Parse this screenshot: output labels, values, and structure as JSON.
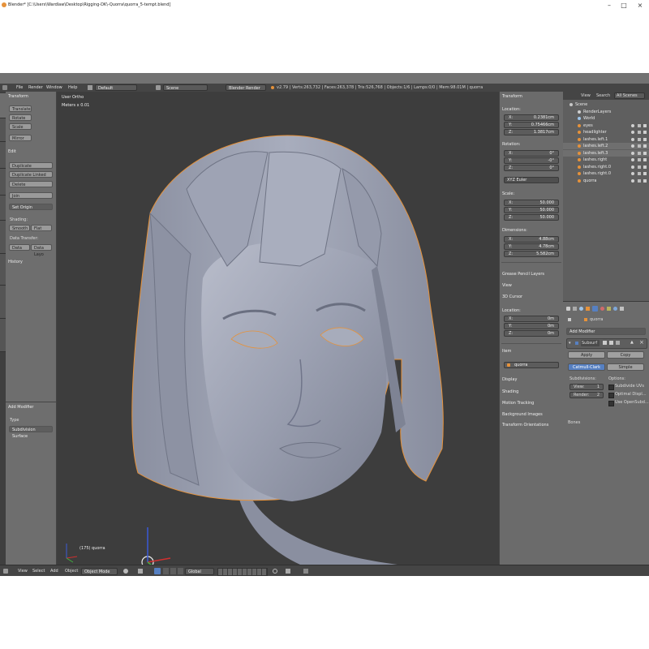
{
  "window": {
    "title": "Blender* [C:\\Users\\Wardlaw\\Desktop\\Rigging-DK\\-Quorra\\quorra_5-tempt.blend]"
  },
  "menu": {
    "file": "File",
    "render": "Render",
    "window": "Window",
    "help": "Help"
  },
  "header": {
    "layout": "Default",
    "scene": "Scene",
    "engine": "Blender Render",
    "stats": "v2.79 | Verts:263,732 | Faces:263,378 | Tris:526,768 | Objects:1/6 | Lamps:0/0 | Mem:98.01M | quorra"
  },
  "tools": {
    "transform_header": "Transform",
    "translate": "Translate",
    "rotate": "Rotate",
    "scale": "Scale",
    "mirror": "Mirror",
    "edit_header": "Edit",
    "duplicate": "Duplicate",
    "duplicate_linked": "Duplicate Linked",
    "delete": "Delete",
    "join": "Join",
    "set_origin": "Set Origin",
    "shading_label": "Shading:",
    "smooth": "Smooth",
    "flat": "Flat",
    "data_transfer_label": "Data Transfer:",
    "data": "Data",
    "data_layout": "Data Layo",
    "history_header": "History",
    "add_modifier_header": "Add Modifier",
    "type_label": "Type",
    "type_value": "Subdivision Surface"
  },
  "viewport": {
    "view_label": "User Ortho",
    "meters_label": "Meters x 0.01",
    "object_label": "(175) quorra"
  },
  "transform_panel": {
    "header": "Transform",
    "location_label": "Location:",
    "location": [
      {
        "axis": "X:",
        "value": "0.2381cm"
      },
      {
        "axis": "Y:",
        "value": "0.75466cm"
      },
      {
        "axis": "Z:",
        "value": "1.3817cm"
      }
    ],
    "rotation_label": "Rotation:",
    "rotation": [
      {
        "axis": "X:",
        "value": "0°"
      },
      {
        "axis": "Y:",
        "value": "-0°"
      },
      {
        "axis": "Z:",
        "value": "0°"
      }
    ],
    "rotation_mode": "XYZ Euler",
    "scale_label": "Scale:",
    "scale": [
      {
        "axis": "X:",
        "value": "50.000"
      },
      {
        "axis": "Y:",
        "value": "50.000"
      },
      {
        "axis": "Z:",
        "value": "50.000"
      }
    ],
    "dimensions_label": "Dimensions:",
    "dimensions": [
      {
        "axis": "X:",
        "value": "4.88cm"
      },
      {
        "axis": "Y:",
        "value": "4.78cm"
      },
      {
        "axis": "Z:",
        "value": "5.582cm"
      }
    ],
    "grease_pencil": "Grease Pencil Layers",
    "view": "View",
    "cursor": "3D Cursor",
    "cursor_location_label": "Location:",
    "cursor_location": [
      {
        "axis": "X:",
        "value": "0m"
      },
      {
        "axis": "Y:",
        "value": "0m"
      },
      {
        "axis": "Z:",
        "value": "0m"
      }
    ],
    "item": "Item",
    "item_name": "quorra",
    "display": "Display",
    "shading": "Shading",
    "motion_tracking": "Motion Tracking",
    "background_images": "Background Images",
    "transform_orientations": "Transform Orientations"
  },
  "outliner": {
    "menu_view": "View",
    "menu_search": "Search",
    "menu_scenes": "All Scenes",
    "items": [
      {
        "label": "Scene",
        "indent": 0,
        "icon_color": "#c8c8c8"
      },
      {
        "label": "RenderLayers",
        "indent": 1,
        "icon_color": "#cfcfcf"
      },
      {
        "label": "World",
        "indent": 1,
        "icon_color": "#9ec4e8"
      },
      {
        "label": "eyes",
        "indent": 1,
        "icon_color": "#e6923a"
      },
      {
        "label": "headlighter",
        "indent": 1,
        "icon_color": "#e6923a"
      },
      {
        "label": "lashes.left.1",
        "indent": 1,
        "icon_color": "#e6923a"
      },
      {
        "label": "lashes.left.2",
        "indent": 1,
        "icon_color": "#e6923a"
      },
      {
        "label": "lashes.left.3",
        "indent": 1,
        "icon_color": "#e6923a"
      },
      {
        "label": "lashes.right",
        "indent": 1,
        "icon_color": "#e6923a"
      },
      {
        "label": "lashes.right.0",
        "indent": 1,
        "icon_color": "#e6923a"
      },
      {
        "label": "lashes.right.0",
        "indent": 1,
        "icon_color": "#e6923a"
      },
      {
        "label": "quorra",
        "indent": 1,
        "icon_color": "#e6923a"
      }
    ]
  },
  "properties": {
    "breadcrumb": "quorra",
    "add_modifier": "Add Modifier",
    "modifier_name": "Subsurf",
    "apply": "Apply",
    "copy": "Copy",
    "catmull_clark": "Catmull-Clark",
    "simple": "Simple",
    "subdivisions_label": "Subdivisions:",
    "view_label": "View:",
    "view_value": "1",
    "render_label": "Render:",
    "render_value": "2",
    "options_label": "Options:",
    "subdivide_uvs": "Subdivide UVs",
    "optimal_display": "Optimal Displ...",
    "use_opensubdiv": "Use OpenSubd...",
    "bones": "Bones"
  },
  "bottombar": {
    "view": "View",
    "select": "Select",
    "add": "Add",
    "object": "Object",
    "mode": "Object Mode",
    "orientation": "Global"
  },
  "colors": {
    "accent": "#5680c2",
    "object_outline": "#e6923a",
    "viewport_bg": "#3d3d3d",
    "mesh": "#9a9fb0"
  }
}
